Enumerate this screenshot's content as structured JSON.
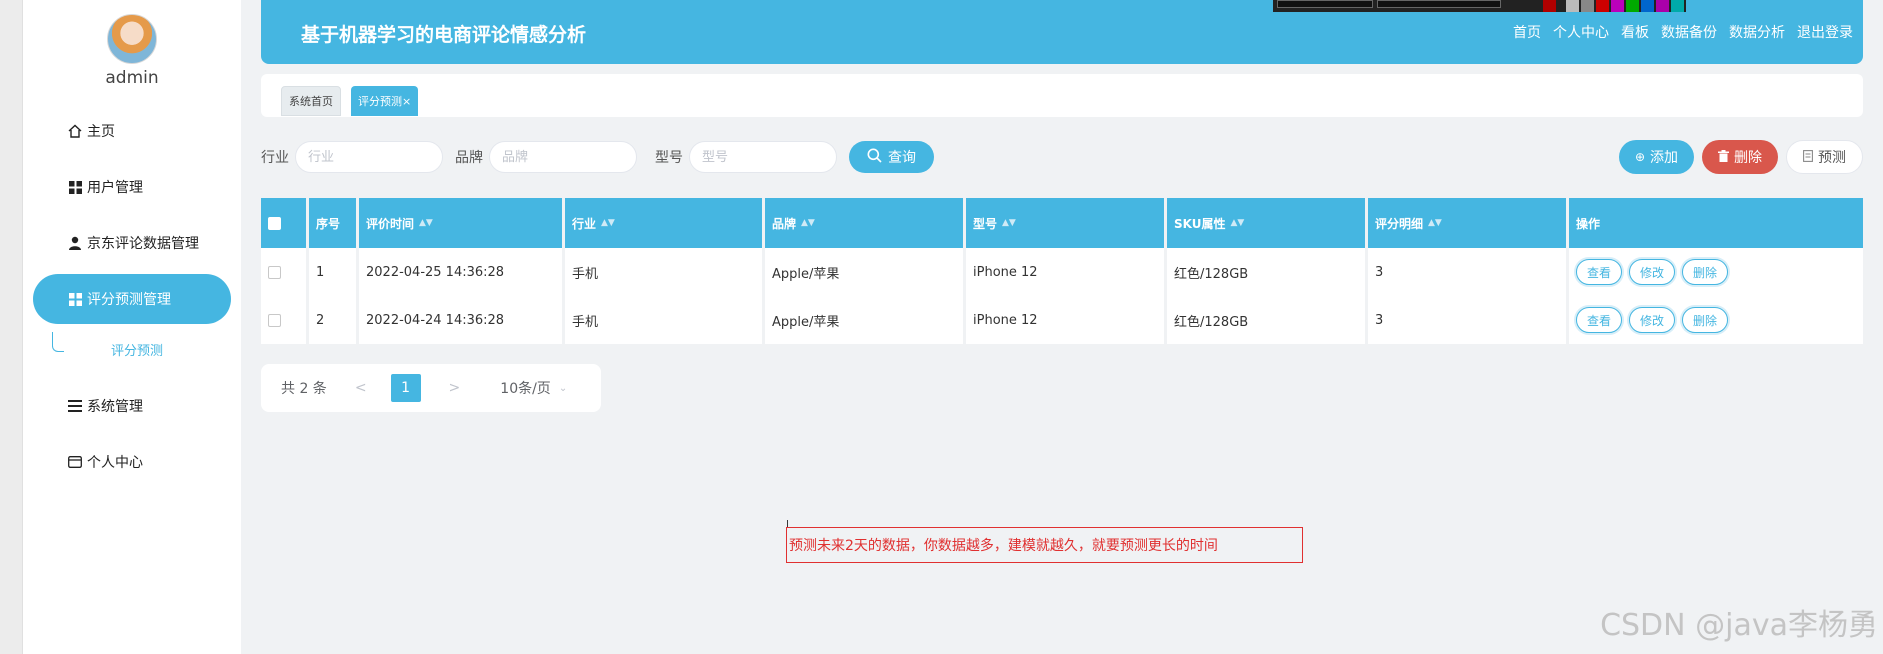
{
  "user": {
    "name": "admin"
  },
  "sidebar": {
    "items": [
      {
        "label": "主页",
        "icon": "home-icon"
      },
      {
        "label": "用户管理",
        "icon": "grid-icon"
      },
      {
        "label": "京东评论数据管理",
        "icon": "user-icon"
      },
      {
        "label": "评分预测管理",
        "icon": "grid-icon",
        "active": true
      },
      {
        "label": "系统管理",
        "icon": "list-icon"
      },
      {
        "label": "个人中心",
        "icon": "card-icon"
      }
    ],
    "subitem": "评分预测"
  },
  "header": {
    "title": "基于机器学习的电商评论情感分析",
    "links": [
      "首页",
      "个人中心",
      "看板",
      "数据备份",
      "数据分析",
      "退出登录"
    ]
  },
  "tabs": {
    "home": "系统首页",
    "active": "评分预测×"
  },
  "search": {
    "industry_label": "行业",
    "industry_placeholder": "行业",
    "brand_label": "品牌",
    "brand_placeholder": "品牌",
    "model_label": "型号",
    "model_placeholder": "型号",
    "query_label": "查询"
  },
  "actions": {
    "add": "添加",
    "delete": "删除",
    "predict": "预测"
  },
  "table": {
    "headers": [
      "序号",
      "评价时间",
      "行业",
      "品牌",
      "型号",
      "SKU属性",
      "评分明细",
      "操作"
    ],
    "rows": [
      {
        "no": "1",
        "time": "2022-04-25 14:36:28",
        "industry": "手机",
        "brand": "Apple/苹果",
        "model": "iPhone 12",
        "sku": "红色/128GB",
        "score": "3"
      },
      {
        "no": "2",
        "time": "2022-04-24 14:36:28",
        "industry": "手机",
        "brand": "Apple/苹果",
        "model": "iPhone 12",
        "sku": "红色/128GB",
        "score": "3"
      }
    ],
    "row_ops": {
      "view": "查看",
      "edit": "修改",
      "delete": "删除"
    }
  },
  "pager": {
    "total": "共 2 条",
    "prev": "<",
    "page": "1",
    "next": ">",
    "size": "10条/页"
  },
  "note": "预测未来2天的数据，你数据越多，建模就越久，就要预测更长的时间",
  "watermark": "CSDN @java李杨勇",
  "colors": {
    "primary": "#45b6e1",
    "danger": "#d9574c",
    "note": "#e03030"
  }
}
